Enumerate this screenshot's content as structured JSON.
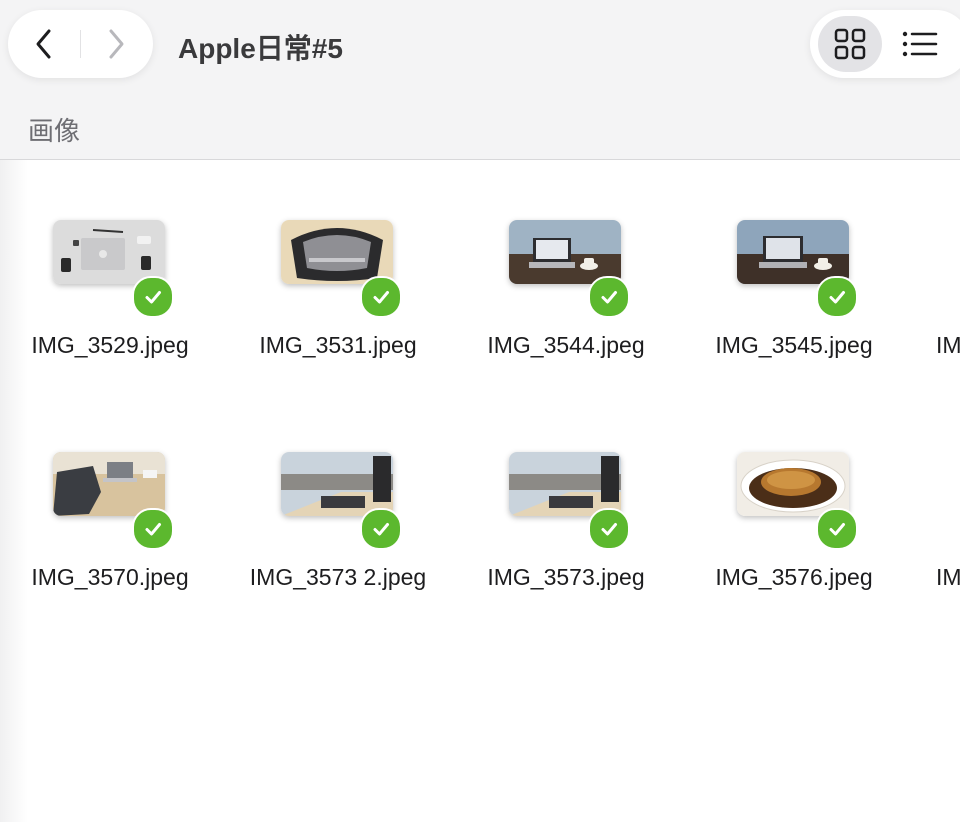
{
  "toolbar": {
    "back_icon": "chevron-left-icon",
    "forward_icon": "chevron-right-icon",
    "title": "Apple日常#5",
    "grid_view_icon": "grid-view-icon",
    "list_view_icon": "list-view-icon"
  },
  "section": {
    "label": "画像"
  },
  "files": [
    {
      "name": "IMG_3529.jpeg",
      "thumb": "desk-flatlay"
    },
    {
      "name": "IMG_3531.jpeg",
      "thumb": "bag"
    },
    {
      "name": "IMG_3544.jpeg",
      "thumb": "laptop-window"
    },
    {
      "name": "IMG_3545.jpeg",
      "thumb": "laptop-window"
    },
    {
      "name": "IMG_3570.jpeg",
      "thumb": "chair-desk"
    },
    {
      "name": "IMG_3573 2.jpeg",
      "thumb": "airport-window"
    },
    {
      "name": "IMG_3573.jpeg",
      "thumb": "airport-window"
    },
    {
      "name": "IMG_3576.jpeg",
      "thumb": "katsu-curry"
    }
  ],
  "partial_files": [
    {
      "name": "IM"
    },
    {
      "name": "IM"
    }
  ],
  "colors": {
    "check": "#5cb82e",
    "toolbar_bg": "#f4f4f5"
  }
}
